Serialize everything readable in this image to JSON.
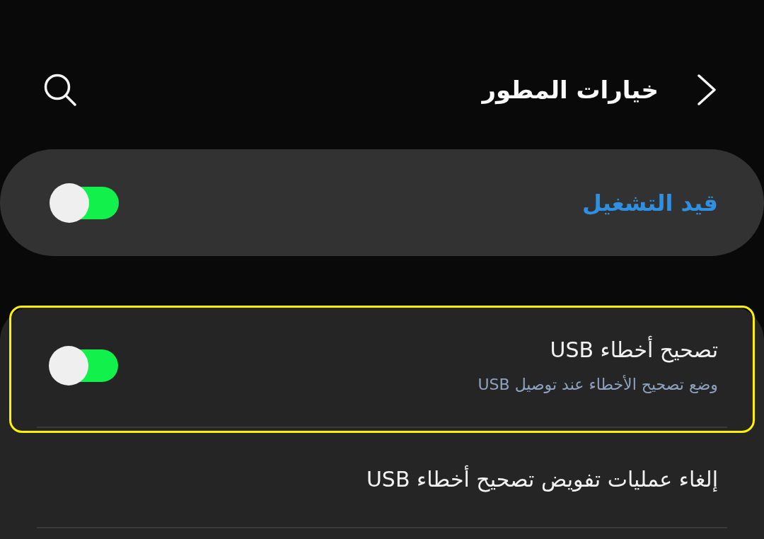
{
  "header": {
    "title": "خيارات المطور"
  },
  "master_switch": {
    "label": "قيد التشغيل",
    "on": true
  },
  "settings": [
    {
      "kind": "switch",
      "title": "تصحيح أخطاء USB",
      "summary": "وضع تصحيح الأخطاء عند توصيل USB",
      "on": true,
      "highlighted": true
    },
    {
      "kind": "action",
      "title": "إلغاء عمليات تفويض تصحيح أخطاء USB",
      "highlighted": false
    }
  ]
}
